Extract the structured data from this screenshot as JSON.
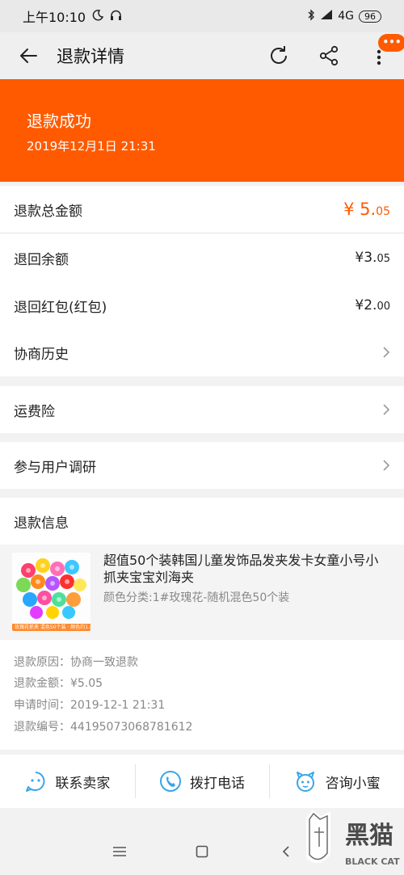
{
  "status_bar": {
    "time": "上午10:10",
    "network": "4G",
    "battery": "96"
  },
  "nav": {
    "title": "退款详情",
    "more_badge": "•••"
  },
  "banner": {
    "status": "退款成功",
    "time": "2019年12月1日 21:31"
  },
  "amounts": {
    "total_label": "退款总金额",
    "total_symbol": "¥",
    "total_int": "5.",
    "total_dec": "05",
    "balance_label": "退回余额",
    "balance_symbol": "¥",
    "balance_int": "3.",
    "balance_dec": "05",
    "redpacket_label": "退回红包(红包)",
    "redpacket_symbol": "¥",
    "redpacket_int": "2.",
    "redpacket_dec": "00",
    "history_label": "协商历史"
  },
  "freight": {
    "label": "运费险"
  },
  "survey": {
    "label": "参与用户调研"
  },
  "refund_info": {
    "heading": "退款信息",
    "product_title": "超值50个装韩国儿童发饰品发夹发卡女童小号小抓夹宝宝刘海夹",
    "product_sku": "颜色分类:1#玫瑰花-随机混色50个装",
    "thumb_caption": "玫瑰花抓夹 混色50个装 · 颜色约1.8cm",
    "reason": "退款原因：协商一致退款",
    "amount": "退款金额：¥5.05",
    "apply_time": "申请时间：2019-12-1 21:31",
    "refund_no": "退款编号：44195073068781612"
  },
  "actions": [
    {
      "label": "联系卖家",
      "icon": "chat-face-icon"
    },
    {
      "label": "拨打电话",
      "icon": "phone-icon"
    },
    {
      "label": "咨询小蜜",
      "icon": "assistant-icon"
    }
  ],
  "watermark": {
    "text": "黑猫",
    "subtext": "BLACK CAT"
  },
  "colors": {
    "accent": "#ff5a00",
    "icon_blue": "#3aa6e8"
  }
}
